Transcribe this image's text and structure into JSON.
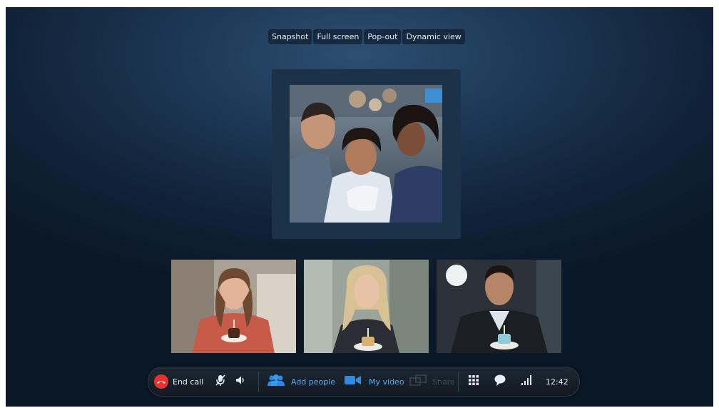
{
  "view_toolbar": {
    "snapshot": "Snapshot",
    "full_screen": "Full screen",
    "pop_out": "Pop-out",
    "dynamic_view": "Dynamic view"
  },
  "call_bar": {
    "end_call": "End call",
    "add_people": "Add people",
    "my_video": "My video",
    "share": "Share",
    "time": "12:42"
  },
  "colors": {
    "end_call_red": "#e8322b",
    "accent_blue": "#2b8be6"
  },
  "icons": [
    "phone-hangup-icon",
    "mute-microphone-icon",
    "speaker-icon",
    "add-people-icon",
    "video-camera-icon",
    "share-screen-icon",
    "dialpad-icon",
    "chat-bubble-icon",
    "signal-strength-icon"
  ]
}
